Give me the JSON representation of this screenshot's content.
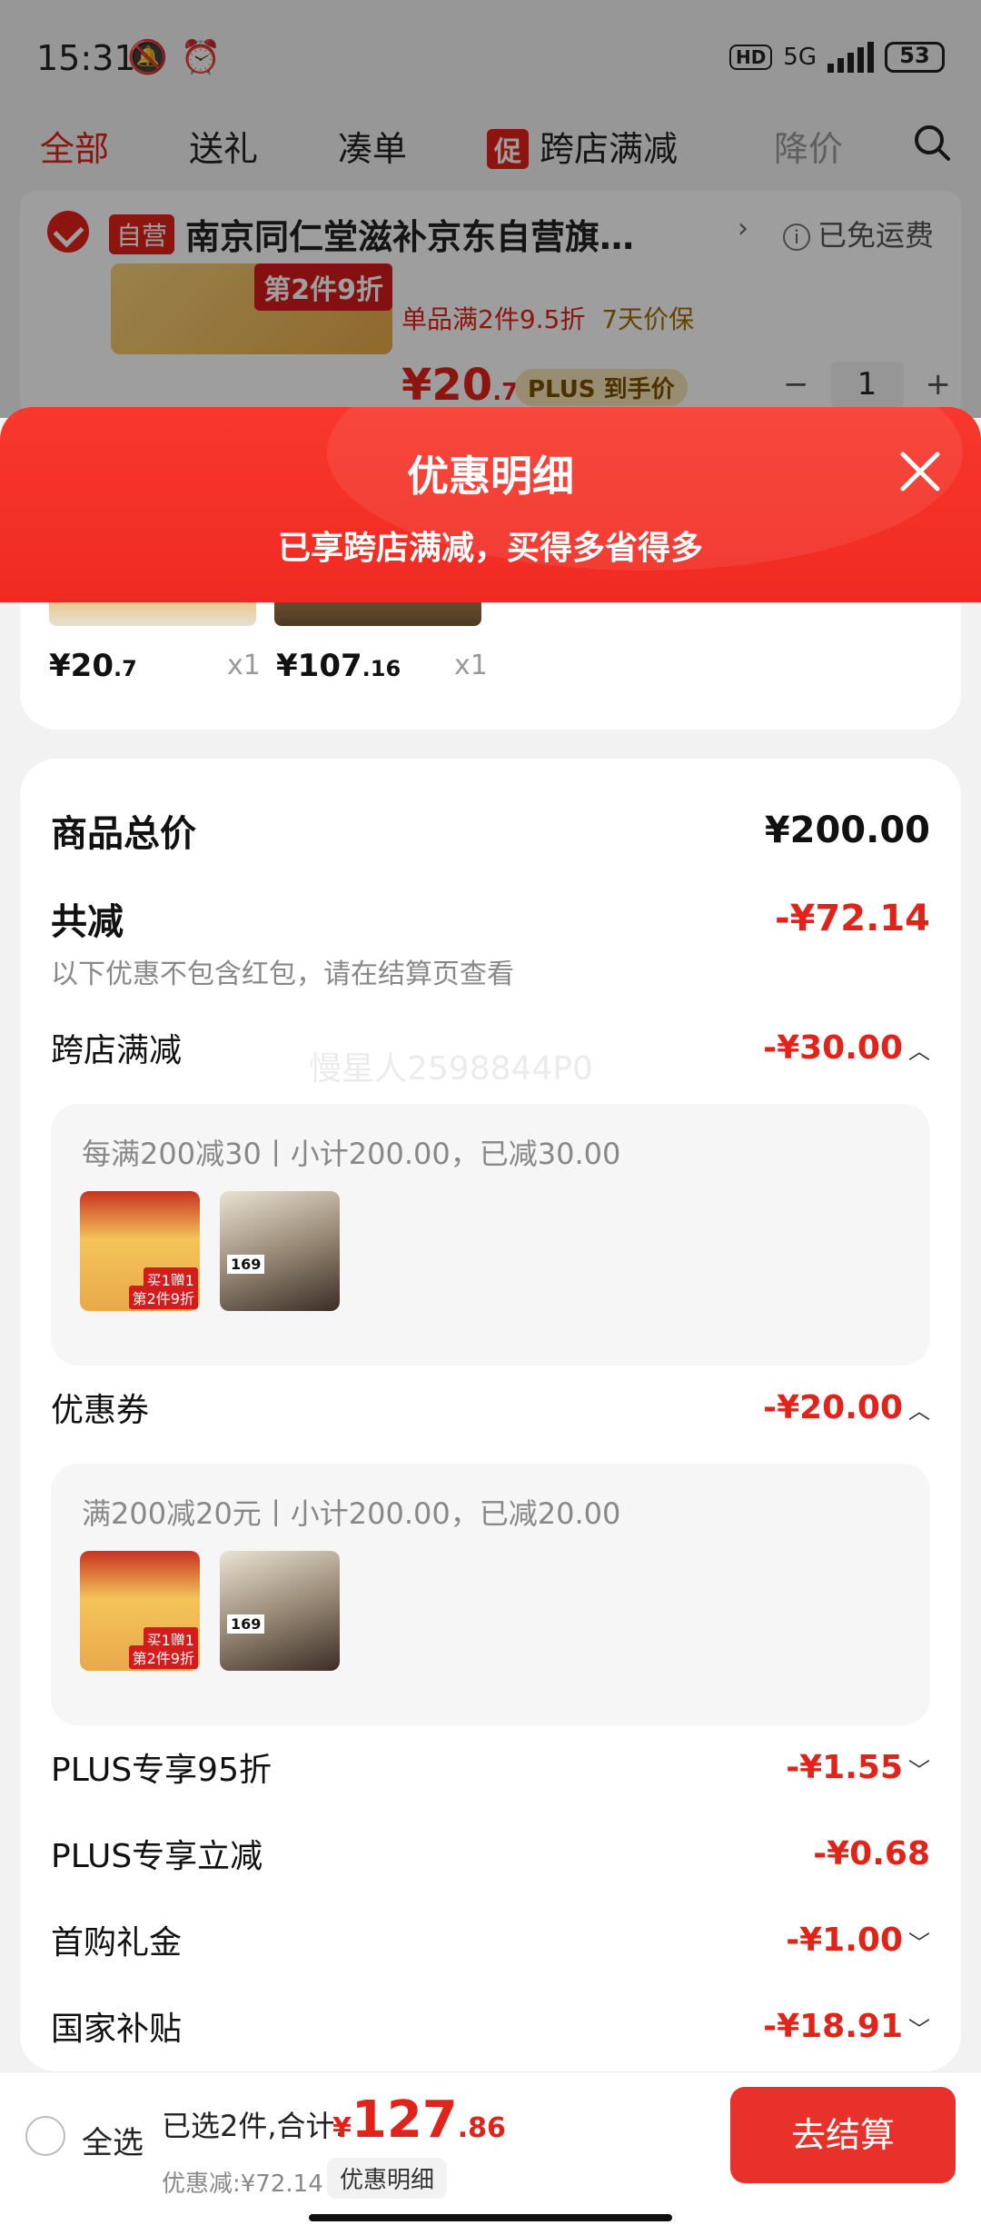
{
  "status_bar": {
    "time": "15:31",
    "network": "5G",
    "hd": "HD",
    "battery": "53"
  },
  "tabs": [
    {
      "label": "全部",
      "active": true
    },
    {
      "label": "送礼"
    },
    {
      "label": "凑单"
    },
    {
      "label": "跨店满减",
      "badge": "促"
    },
    {
      "label": "降价"
    }
  ],
  "store": {
    "self_operated": "自营",
    "name": "南京同仁堂滋补京东自营旗…",
    "shipping": "已免运费",
    "image_tag": "第2件9折",
    "promo": "单品满2件9.5折",
    "promo_extra": "7天价保",
    "price_int": "20",
    "price_dec": ".7",
    "plus_label": "PLUS 到手价",
    "qty": "1"
  },
  "sheet": {
    "title": "优惠明细",
    "subtitle": "已享跨店满减，买得多省得多",
    "items": [
      {
        "price_int": "¥20",
        "price_dec": ".7",
        "qty": "x1"
      },
      {
        "price_int": "¥107",
        "price_dec": ".16",
        "qty": "x1"
      }
    ],
    "total_label": "商品总价",
    "total_value": "¥200.00",
    "reduce_label": "共减",
    "reduce_value": "-¥72.14",
    "note": "以下优惠不包含红包，请在结算页查看",
    "cross_store": {
      "label": "跨店满减",
      "value": "-¥30.00",
      "detail": "每满200减30丨小计200.00，已减30.00"
    },
    "coupon": {
      "label": "优惠券",
      "value": "-¥20.00",
      "detail": "满200减20元丨小计200.00，已减20.00"
    },
    "rows": [
      {
        "label": "PLUS专享95折",
        "value": "-¥1.55"
      },
      {
        "label": "PLUS专享立减",
        "value": "-¥0.68"
      },
      {
        "label": "首购礼金",
        "value": "-¥1.00"
      },
      {
        "label": "国家补贴",
        "value": "-¥18.91"
      }
    ],
    "thumb_tags": {
      "gift": "买1赠1",
      "discount": "第2件9折",
      "price": "169"
    },
    "watermark": "慢星人2598844P0"
  },
  "bottom_bar": {
    "select_all": "全选",
    "selected_text": "已选2件,合计:",
    "total_symbol": "¥",
    "total_int": "127",
    "total_dec": ".86",
    "discount_text": "优惠减:¥72.14",
    "detail_button": "优惠明细",
    "checkout_button": "去结算"
  },
  "colors": {
    "accent": "#e2231a",
    "sheet_header": "#f8382c"
  }
}
